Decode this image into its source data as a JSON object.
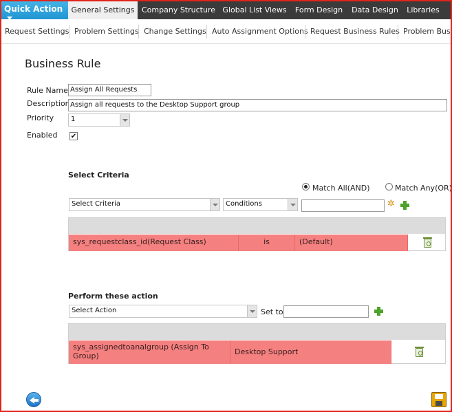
{
  "topnav": {
    "quick_action": "Quick Action",
    "tabs": [
      "General Settings",
      "Company Structure",
      "Global List Views",
      "Form Design",
      "Data Design",
      "Libraries"
    ]
  },
  "subnav": {
    "tabs": [
      "Request Settings",
      "Problem Settings",
      "Change Settings",
      "Auto Assignment Options",
      "Request Business Rules",
      "Problem Busin"
    ]
  },
  "form": {
    "title": "Business Rule",
    "rule_name_label": "Rule Name",
    "rule_name_value": "Assign All Requests",
    "description_label": "Description",
    "description_value": "Assign all requests to the Desktop Support group",
    "priority_label": "Priority",
    "priority_value": "1",
    "enabled_label": "Enabled",
    "enabled_checked": true,
    "enabled_mark": "✔"
  },
  "criteria": {
    "title": "Select Criteria",
    "match_all_label": "Match All(AND)",
    "match_any_label": "Match Any(OR)",
    "select_criteria": "Select Criteria",
    "conditions": "Conditions",
    "value": "",
    "rows": [
      {
        "field": "sys_requestclass_id(Request Class)",
        "operator": "is",
        "value": "(Default)"
      }
    ]
  },
  "actions": {
    "title": "Perform these action",
    "select_action": "Select Action",
    "set_to_label": "Set to",
    "set_to_value": "",
    "rows": [
      {
        "field": "sys_assignedtoanalgroup (Assign To Group)",
        "value": "Desktop Support"
      }
    ]
  },
  "colors": {
    "accent": "#2095d2",
    "nav_bg": "#3b3b3b",
    "row_highlight": "#f58080",
    "border_red": "#e2231a"
  },
  "icons": {
    "add": "plus-icon",
    "wand": "magic-wand-icon",
    "delete": "recycle-bin-icon",
    "back": "back-arrow-icon",
    "save": "save-icon"
  }
}
